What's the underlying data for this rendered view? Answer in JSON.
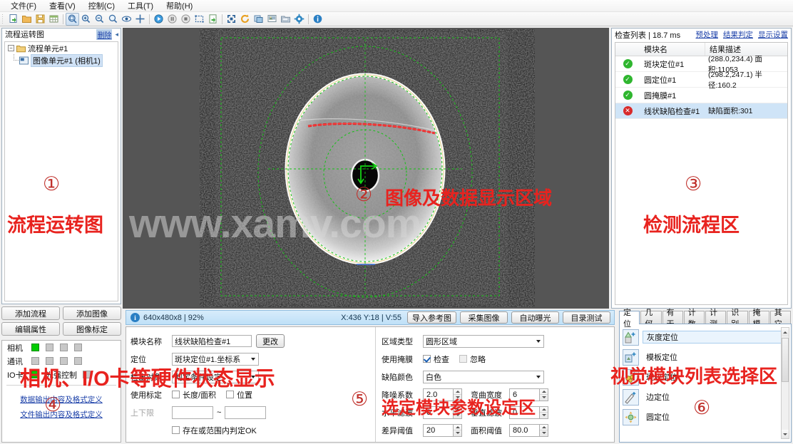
{
  "menubar": {
    "items": [
      {
        "label": "文件(F)",
        "name": "menu-file"
      },
      {
        "label": "查看(V)",
        "name": "menu-view"
      },
      {
        "label": "控制(C)",
        "name": "menu-control"
      },
      {
        "label": "工具(T)",
        "name": "menu-tools"
      },
      {
        "label": "帮助(H)",
        "name": "menu-help"
      }
    ]
  },
  "toolbar": {
    "icons": [
      "new-document-icon",
      "open-folder-icon",
      "save-icon",
      "grid-icon",
      "zoom-fit-icon",
      "zoom-in-icon",
      "zoom-out-icon",
      "zoom-actual-icon",
      "eye-icon",
      "crosshair-icon",
      "run-icon",
      "pause-icon",
      "stop-icon",
      "region-icon",
      "export-icon",
      "fullscreen-icon",
      "refresh-icon",
      "copy-image-icon",
      "image-stack-icon",
      "save-as-icon",
      "settings-gear-icon",
      "info-icon"
    ]
  },
  "flow_panel": {
    "title": "流程运转图",
    "delete_label": "删除",
    "collapse_icon": "collapse-left-icon",
    "tree": [
      {
        "label": "流程单元#1",
        "icon": "flow-unit-icon",
        "selected": false
      },
      {
        "label": "图像单元#1 (相机1)",
        "icon": "image-unit-icon",
        "selected": true
      }
    ]
  },
  "flow_buttons": [
    {
      "label": "添加流程",
      "name": "add-flow-button"
    },
    {
      "label": "添加图像",
      "name": "add-image-button"
    },
    {
      "label": "编辑属性",
      "name": "edit-property-button"
    },
    {
      "label": "图像标定",
      "name": "image-calibration-button"
    }
  ],
  "hardware": {
    "rows": [
      {
        "label": "相机",
        "leds": [
          "on",
          "off",
          "off",
          "off"
        ]
      },
      {
        "label": "通讯",
        "leds": [
          "off",
          "off",
          "off",
          "off"
        ]
      },
      {
        "label": "IO卡",
        "leds": [
          "on"
        ],
        "sub_label": "光强控制",
        "sub_led": "off"
      }
    ],
    "links": [
      "数据输出内容及格式定义",
      "文件输出内容及格式定义"
    ]
  },
  "status_strip": {
    "info_icon": "info-icon",
    "image_info": "640x480x8 | 92%",
    "coords": "X:436 Y:18 | V:55",
    "buttons": [
      {
        "label": "导入参考图",
        "name": "import-reference-button"
      },
      {
        "label": "采集图像",
        "name": "capture-image-button"
      },
      {
        "label": "自动曝光",
        "name": "auto-exposure-button"
      },
      {
        "label": "目录测试",
        "name": "directory-test-button"
      }
    ]
  },
  "params": {
    "left": {
      "module_name_label": "模块名称",
      "module_name_value": "线状缺陷检查#1",
      "change_button": "更改",
      "locate_label": "定位",
      "locate_value": "斑块定位#1.坐标系",
      "hidden_row_label": "检出对象",
      "hidden_row_value": "判定条件设定",
      "use_calib_label": "使用标定",
      "calib_len_area": "长度/面积",
      "calib_pos": "位置",
      "limit_label": "上下限",
      "limit_lower": "",
      "limit_upper": "",
      "tilde": "~",
      "exists_ok_label": "存在或范围内判定OK"
    },
    "right": {
      "region_type_label": "区域类型",
      "region_type_value": "圆形区域",
      "use_mask_label": "使用掩膜",
      "mask_check": "检查",
      "mask_ignore": "忽略",
      "defect_color_label": "缺陷颜色",
      "defect_color_value": "白色",
      "noise_coef_label": "降噪系数",
      "noise_coef_value": "2.0",
      "bend_width_label": "弯曲宽度",
      "bend_width_value": "6",
      "h_filter_label": "水平滤波",
      "h_filter_value": "0",
      "v_filter_label": "垂直滤波",
      "v_filter_value": "0",
      "diff_thresh_label": "差异阈值",
      "diff_thresh_value": "20",
      "area_thresh_label": "面积阈值",
      "area_thresh_value": "80.0"
    }
  },
  "inspection": {
    "title": "检查列表 | 18.7 ms",
    "links": [
      {
        "label": "预处理",
        "name": "preprocess-link"
      },
      {
        "label": "结果判定",
        "name": "result-judge-link"
      },
      {
        "label": "显示设置",
        "name": "display-settings-link"
      }
    ],
    "columns": [
      "",
      "模块名",
      "结果描述"
    ],
    "rows": [
      {
        "status": "ok",
        "module": "斑块定位#1",
        "result": "(288.0,234.4) 面积:11053",
        "selected": false
      },
      {
        "status": "ok",
        "module": "圆定位#1",
        "result": "(298.2,247.1) 半径:160.2",
        "selected": false
      },
      {
        "status": "ok",
        "module": "圆掩膜#1",
        "result": "",
        "selected": false
      },
      {
        "status": "ng",
        "module": "线状缺陷检查#1",
        "result": "缺陷面积:301",
        "selected": true
      }
    ]
  },
  "modules": {
    "tabs": [
      {
        "label": "定位",
        "active": true
      },
      {
        "label": "几何",
        "active": false
      },
      {
        "label": "有无",
        "active": false
      },
      {
        "label": "计数",
        "active": false
      },
      {
        "label": "计测",
        "active": false
      },
      {
        "label": "识别",
        "active": false
      },
      {
        "label": "掩模",
        "active": false
      },
      {
        "label": "其它",
        "active": false
      }
    ],
    "items": [
      {
        "label": "灰度定位",
        "icon": "gray-locate-icon",
        "selected": true
      },
      {
        "label": "模板定位",
        "icon": "template-locate-icon",
        "selected": false
      },
      {
        "label": "斑块定位",
        "icon": "blob-locate-icon",
        "selected": false
      },
      {
        "label": "边定位",
        "icon": "edge-locate-icon",
        "selected": false
      },
      {
        "label": "圆定位",
        "icon": "circle-locate-icon",
        "selected": false
      }
    ]
  },
  "annotations": {
    "a1_num": "①",
    "a1_text": "流程运转图",
    "a2_num": "②",
    "a2_text": "图像及数据显示区域",
    "a3_num": "③",
    "a3_text": "检测流程区",
    "a4_num": "④",
    "a4_text": "相机、I/O卡等硬件状态显示",
    "a5_num": "⑤",
    "a5_text": "选定模块参数设定区",
    "a6_num": "⑥",
    "a6_text": "视觉模块列表选择区",
    "watermark": "www.xamv.com"
  },
  "colors": {
    "accent_blue": "#1a3fa8",
    "status_ok": "#2fb62f",
    "status_ng": "#d82a2a",
    "annotation_red": "#e8231f",
    "led_on": "#00cc00"
  }
}
